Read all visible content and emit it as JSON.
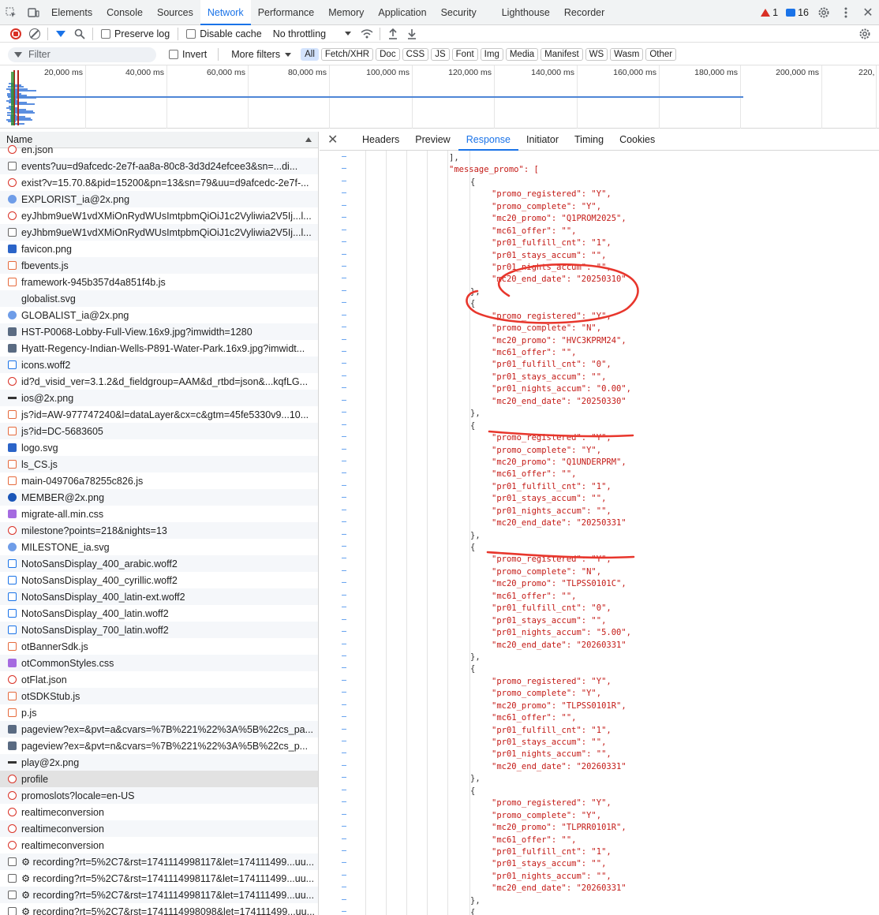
{
  "devtools": {
    "tabs": [
      "Elements",
      "Console",
      "Sources",
      "Network",
      "Performance",
      "Memory",
      "Application",
      "Security",
      "Lighthouse",
      "Recorder"
    ],
    "active_tab": "Network",
    "warnings_count": "1",
    "messages_count": "16"
  },
  "toolbar": {
    "preserve_log": "Preserve log",
    "disable_cache": "Disable cache",
    "throttling": "No throttling"
  },
  "filter": {
    "placeholder": "Filter",
    "invert": "Invert",
    "more_filters": "More filters",
    "chips": [
      "All",
      "Fetch/XHR",
      "Doc",
      "CSS",
      "JS",
      "Font",
      "Img",
      "Media",
      "Manifest",
      "WS",
      "Wasm",
      "Other"
    ]
  },
  "overview": {
    "ticks": [
      "20,000 ms",
      "40,000 ms",
      "60,000 ms",
      "80,000 ms",
      "100,000 ms",
      "120,000 ms",
      "140,000 ms",
      "160,000 ms",
      "180,000 ms",
      "200,000 ms",
      "220,"
    ]
  },
  "request_list": {
    "header": "Name",
    "rows": [
      {
        "name": "en.json",
        "icon": "fetch-icon"
      },
      {
        "name": "events?uu=d9afcedc-2e7f-aa8a-80c8-3d3d24efcee3&sn=...di...",
        "icon": "document-icon"
      },
      {
        "name": "exist?v=15.70.8&pid=15200&pn=13&sn=79&uu=d9afcedc-2e7f-...",
        "icon": "fetch-icon"
      },
      {
        "name": "EXPLORIST_ia@2x.png",
        "icon": "image-icon"
      },
      {
        "name": "eyJhbm9ueW1vdXMiOnRydWUsImtpbmQiOiJ1c2Vyliwia2V5Ij...l...",
        "icon": "fetch-icon"
      },
      {
        "name": "eyJhbm9ueW1vdXMiOnRydWUsImtpbmQiOiJ1c2Vyliwia2V5Ij...l...",
        "icon": "document-icon"
      },
      {
        "name": "favicon.png",
        "icon": "image-icon"
      },
      {
        "name": "fbevents.js",
        "icon": "script-icon"
      },
      {
        "name": "framework-945b357d4a851f4b.js",
        "icon": "script-icon"
      },
      {
        "name": "globalist.svg",
        "icon": "image-icon"
      },
      {
        "name": "GLOBALIST_ia@2x.png",
        "icon": "image-icon"
      },
      {
        "name": "HST-P0068-Lobby-Full-View.16x9.jpg?imwidth=1280",
        "icon": "image-icon"
      },
      {
        "name": "Hyatt-Regency-Indian-Wells-P891-Water-Park.16x9.jpg?imwidt...",
        "icon": "image-icon"
      },
      {
        "name": "icons.woff2",
        "icon": "font-icon"
      },
      {
        "name": "id?d_visid_ver=3.1.2&d_fieldgroup=AAM&d_rtbd=json&...kqfLG...",
        "icon": "fetch-icon"
      },
      {
        "name": "ios@2x.png",
        "icon": "image-icon"
      },
      {
        "name": "js?id=AW-977747240&l=dataLayer&cx=c&gtm=45fe5330v9...10...",
        "icon": "script-icon"
      },
      {
        "name": "js?id=DC-5683605",
        "icon": "script-icon"
      },
      {
        "name": "logo.svg",
        "icon": "image-icon"
      },
      {
        "name": "ls_CS.js",
        "icon": "script-icon"
      },
      {
        "name": "main-049706a78255c826.js",
        "icon": "script-icon"
      },
      {
        "name": "MEMBER@2x.png",
        "icon": "image-icon"
      },
      {
        "name": "migrate-all.min.css",
        "icon": "stylesheet-icon"
      },
      {
        "name": "milestone?points=218&nights=13",
        "icon": "fetch-icon"
      },
      {
        "name": "MILESTONE_ia.svg",
        "icon": "image-icon"
      },
      {
        "name": "NotoSansDisplay_400_arabic.woff2",
        "icon": "font-icon"
      },
      {
        "name": "NotoSansDisplay_400_cyrillic.woff2",
        "icon": "font-icon"
      },
      {
        "name": "NotoSansDisplay_400_latin-ext.woff2",
        "icon": "font-icon"
      },
      {
        "name": "NotoSansDisplay_400_latin.woff2",
        "icon": "font-icon"
      },
      {
        "name": "NotoSansDisplay_700_latin.woff2",
        "icon": "font-icon"
      },
      {
        "name": "otBannerSdk.js",
        "icon": "script-icon"
      },
      {
        "name": "otCommonStyles.css",
        "icon": "stylesheet-icon"
      },
      {
        "name": "otFlat.json",
        "icon": "fetch-icon"
      },
      {
        "name": "otSDKStub.js",
        "icon": "script-icon"
      },
      {
        "name": "p.js",
        "icon": "script-icon"
      },
      {
        "name": "pageview?ex=&pvt=a&cvars=%7B%221%22%3A%5B%22cs_pa...",
        "icon": "image-icon"
      },
      {
        "name": "pageview?ex=&pvt=n&cvars=%7B%221%22%3A%5B%22cs_p...",
        "icon": "image-icon"
      },
      {
        "name": "play@2x.png",
        "icon": "image-icon"
      },
      {
        "name": "profile",
        "icon": "fetch-icon",
        "selected": true
      },
      {
        "name": "promoslots?locale=en-US",
        "icon": "fetch-icon"
      },
      {
        "name": "realtimeconversion",
        "icon": "fetch-icon"
      },
      {
        "name": "realtimeconversion",
        "icon": "fetch-icon"
      },
      {
        "name": "realtimeconversion",
        "icon": "fetch-icon"
      },
      {
        "name": "⚙ recording?rt=5%2C7&rst=1741114998117&let=174111499...uu...",
        "icon": "document-icon"
      },
      {
        "name": "⚙ recording?rt=5%2C7&rst=1741114998117&let=174111499...uu...",
        "icon": "document-icon"
      },
      {
        "name": "⚙ recording?rt=5%2C7&rst=1741114998117&let=174111499...uu...",
        "icon": "document-icon"
      },
      {
        "name": "⚙ recording?rt=5%2C7&rst=1741114998098&let=174111499...uu...",
        "icon": "document-icon"
      }
    ]
  },
  "details": {
    "tabs": [
      "Headers",
      "Preview",
      "Response",
      "Initiator",
      "Timing",
      "Cookies"
    ],
    "active_tab": "Response",
    "response_lines": [
      {
        "indent": 0,
        "text": "],"
      },
      {
        "indent": 0,
        "text": "\"message_promo\": ["
      },
      {
        "indent": 1,
        "text": "{"
      },
      {
        "indent": 2,
        "text": "\"promo_registered\": \"Y\","
      },
      {
        "indent": 2,
        "text": "\"promo_complete\": \"Y\","
      },
      {
        "indent": 2,
        "text": "\"mc20_promo\": \"Q1PROM2025\","
      },
      {
        "indent": 2,
        "text": "\"mc61_offer\": \"\","
      },
      {
        "indent": 2,
        "text": "\"pr01_fulfill_cnt\": \"1\","
      },
      {
        "indent": 2,
        "text": "\"pr01_stays_accum\": \"\","
      },
      {
        "indent": 2,
        "text": "\"pr01_nights_accum\": \"\","
      },
      {
        "indent": 2,
        "text": "\"mc20_end_date\": \"20250310\""
      },
      {
        "indent": 1,
        "text": "},"
      },
      {
        "indent": 1,
        "text": "{"
      },
      {
        "indent": 2,
        "text": "\"promo_registered\": \"Y\","
      },
      {
        "indent": 2,
        "text": "\"promo_complete\": \"N\","
      },
      {
        "indent": 2,
        "text": "\"mc20_promo\": \"HVC3KPRM24\","
      },
      {
        "indent": 2,
        "text": "\"mc61_offer\": \"\","
      },
      {
        "indent": 2,
        "text": "\"pr01_fulfill_cnt\": \"0\","
      },
      {
        "indent": 2,
        "text": "\"pr01_stays_accum\": \"\","
      },
      {
        "indent": 2,
        "text": "\"pr01_nights_accum\": \"0.00\","
      },
      {
        "indent": 2,
        "text": "\"mc20_end_date\": \"20250330\""
      },
      {
        "indent": 1,
        "text": "},"
      },
      {
        "indent": 1,
        "text": "{"
      },
      {
        "indent": 2,
        "text": "\"promo_registered\": \"Y\","
      },
      {
        "indent": 2,
        "text": "\"promo_complete\": \"Y\","
      },
      {
        "indent": 2,
        "text": "\"mc20_promo\": \"Q1UNDERPRM\","
      },
      {
        "indent": 2,
        "text": "\"mc61_offer\": \"\","
      },
      {
        "indent": 2,
        "text": "\"pr01_fulfill_cnt\": \"1\","
      },
      {
        "indent": 2,
        "text": "\"pr01_stays_accum\": \"\","
      },
      {
        "indent": 2,
        "text": "\"pr01_nights_accum\": \"\","
      },
      {
        "indent": 2,
        "text": "\"mc20_end_date\": \"20250331\""
      },
      {
        "indent": 1,
        "text": "},"
      },
      {
        "indent": 1,
        "text": "{"
      },
      {
        "indent": 2,
        "text": "\"promo_registered\": \"Y\","
      },
      {
        "indent": 2,
        "text": "\"promo_complete\": \"N\","
      },
      {
        "indent": 2,
        "text": "\"mc20_promo\": \"TLPSS0101C\","
      },
      {
        "indent": 2,
        "text": "\"mc61_offer\": \"\","
      },
      {
        "indent": 2,
        "text": "\"pr01_fulfill_cnt\": \"0\","
      },
      {
        "indent": 2,
        "text": "\"pr01_stays_accum\": \"\","
      },
      {
        "indent": 2,
        "text": "\"pr01_nights_accum\": \"5.00\","
      },
      {
        "indent": 2,
        "text": "\"mc20_end_date\": \"20260331\""
      },
      {
        "indent": 1,
        "text": "},"
      },
      {
        "indent": 1,
        "text": "{"
      },
      {
        "indent": 2,
        "text": "\"promo_registered\": \"Y\","
      },
      {
        "indent": 2,
        "text": "\"promo_complete\": \"Y\","
      },
      {
        "indent": 2,
        "text": "\"mc20_promo\": \"TLPSS0101R\","
      },
      {
        "indent": 2,
        "text": "\"mc61_offer\": \"\","
      },
      {
        "indent": 2,
        "text": "\"pr01_fulfill_cnt\": \"1\","
      },
      {
        "indent": 2,
        "text": "\"pr01_stays_accum\": \"\","
      },
      {
        "indent": 2,
        "text": "\"pr01_nights_accum\": \"\","
      },
      {
        "indent": 2,
        "text": "\"mc20_end_date\": \"20260331\""
      },
      {
        "indent": 1,
        "text": "},"
      },
      {
        "indent": 1,
        "text": "{"
      },
      {
        "indent": 2,
        "text": "\"promo_registered\": \"Y\","
      },
      {
        "indent": 2,
        "text": "\"promo_complete\": \"Y\","
      },
      {
        "indent": 2,
        "text": "\"mc20_promo\": \"TLPRR0101R\","
      },
      {
        "indent": 2,
        "text": "\"mc61_offer\": \"\","
      },
      {
        "indent": 2,
        "text": "\"pr01_fulfill_cnt\": \"1\","
      },
      {
        "indent": 2,
        "text": "\"pr01_stays_accum\": \"\","
      },
      {
        "indent": 2,
        "text": "\"pr01_nights_accum\": \"\","
      },
      {
        "indent": 2,
        "text": "\"mc20_end_date\": \"20260331\""
      },
      {
        "indent": 1,
        "text": "},"
      },
      {
        "indent": 1,
        "text": "{"
      }
    ]
  },
  "colors": {
    "accent": "#1a73e8",
    "annotation": "#e8362c",
    "json_key": "#c41a16"
  }
}
